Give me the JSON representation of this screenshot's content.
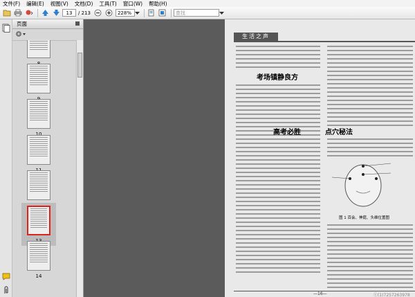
{
  "menubar": {
    "items": [
      "文件(F)",
      "编辑(E)",
      "视图(V)",
      "文档(D)",
      "工具(T)",
      "窗口(W)",
      "帮助(H)"
    ]
  },
  "toolbar": {
    "page_current": "13",
    "page_total": "/ 213",
    "zoom": "228%",
    "search_placeholder": "查找"
  },
  "panel": {
    "title": "页面"
  },
  "thumbnails": [
    {
      "num": "8"
    },
    {
      "num": "9"
    },
    {
      "num": "10"
    },
    {
      "num": "11"
    },
    {
      "num": "12"
    },
    {
      "num": "13"
    },
    {
      "num": "14"
    }
  ],
  "selected_page": "13",
  "document": {
    "header": "生活之声",
    "headings": {
      "h1": "考场镇静良方",
      "h2": "高考必胜",
      "h3": "点穴秘法"
    },
    "caption": "图 1  百会、神庭、头维位置图",
    "page_number": "—16—",
    "watermark": "ⓒ(1)7257263978"
  },
  "colors": {
    "accent": "#e0201b",
    "doc_bg": "#5b5b5b"
  }
}
